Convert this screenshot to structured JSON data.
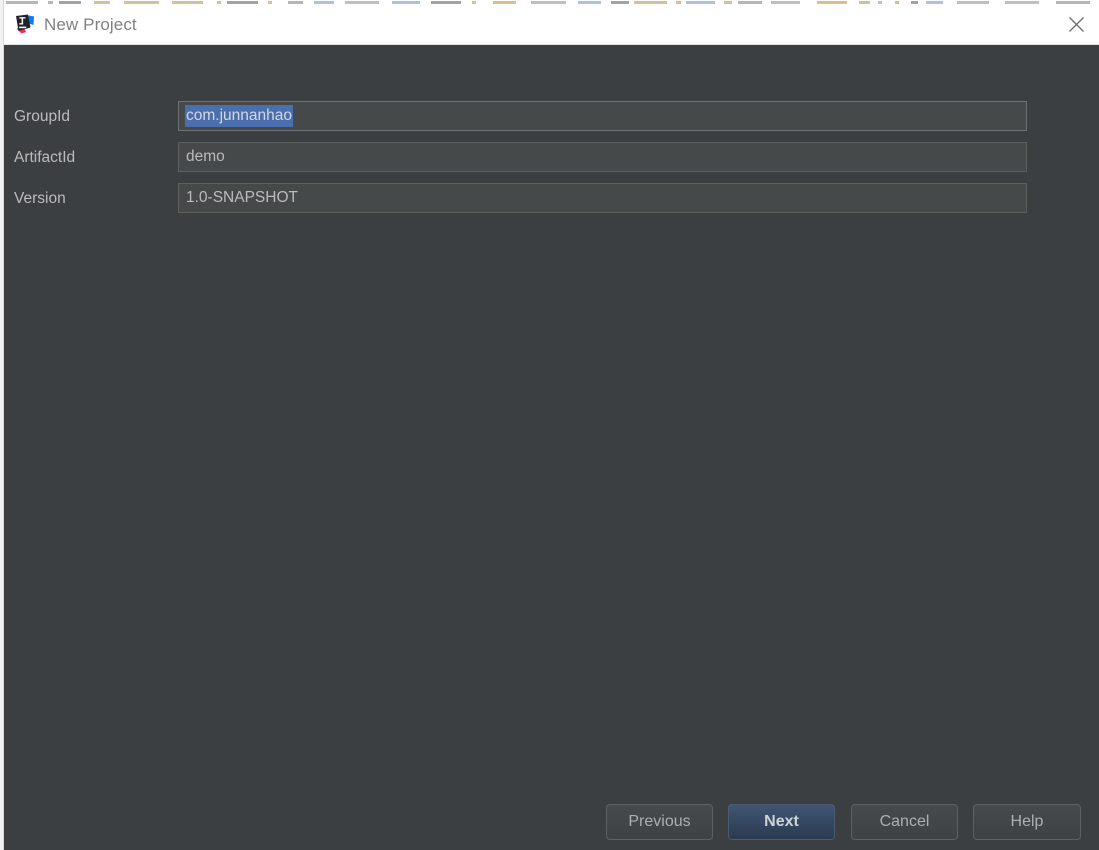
{
  "window": {
    "title": "New Project",
    "app_icon": "intellij-idea-logo-icon",
    "close_icon": "close-icon"
  },
  "form": {
    "rows": [
      {
        "label": "GroupId",
        "value": "com.junnanhao",
        "selected": true,
        "name": "group-id"
      },
      {
        "label": "ArtifactId",
        "value": "demo",
        "selected": false,
        "name": "artifact-id"
      },
      {
        "label": "Version",
        "value": "1.0-SNAPSHOT",
        "selected": false,
        "name": "version"
      }
    ]
  },
  "footer": {
    "previous_label": "Previous",
    "next_label": "Next",
    "cancel_label": "Cancel",
    "help_label": "Help"
  },
  "colors": {
    "dialog_background": "#3c3f41",
    "titlebar_background": "#ffffff",
    "title_text": "#808080",
    "field_background": "#45494a",
    "field_border": "#5e6060",
    "label_text": "#bbbbbb",
    "selection_highlight": "#4b6eaf",
    "default_button_background": "#2b3a50",
    "button_text": "#a9b0b3"
  }
}
